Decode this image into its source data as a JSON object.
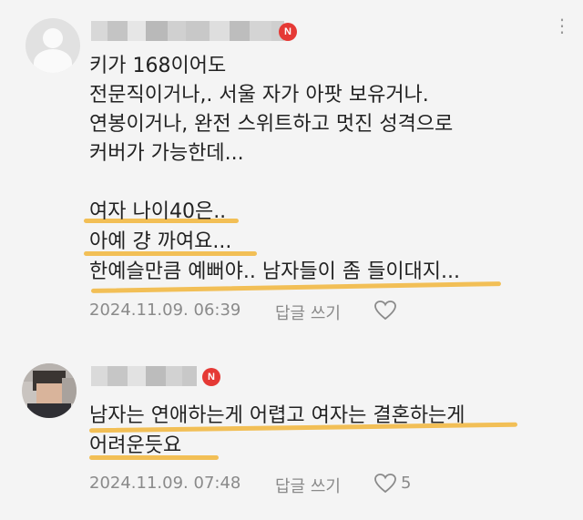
{
  "comments": [
    {
      "badge": "N",
      "lines": [
        "키가 168이어도",
        "전문직이거나,. 서울 자가 아팟 보유거나.",
        "연봉이거나, 완전 스위트하고 멋진 성격으로",
        "커버가 가능한데...",
        "",
        "여자 나이40은..",
        "아예 걍 까여요...",
        "한예슬만큼 예뻐야.. 남자들이 좀 들이대지..."
      ],
      "timestamp": "2024.11.09. 06:39",
      "reply_label": "답글 쓰기",
      "likes": ""
    },
    {
      "badge": "N",
      "lines": [
        "남자는 연애하는게 어렵고 여자는 결혼하는게",
        "어려운듯요"
      ],
      "timestamp": "2024.11.09. 07:48",
      "reply_label": "답글 쓰기",
      "likes": "5"
    }
  ],
  "icons": {
    "more": "more-icon",
    "heart": "heart-icon",
    "badge": "new-badge"
  },
  "colors": {
    "badge": "#e53935",
    "highlight": "#f1b53a",
    "meta": "#8a8a8a"
  }
}
